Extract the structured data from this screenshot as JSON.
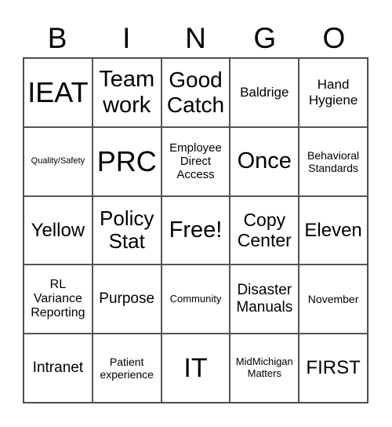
{
  "header": [
    "B",
    "I",
    "N",
    "G",
    "O"
  ],
  "cells": [
    "IEAT",
    "Team work",
    "Good Catch",
    "Baldrige",
    "Hand Hygiene",
    "Quality/Safety",
    "PRC",
    "Employee Direct Access",
    "Once",
    "Behavioral Standards",
    "Yellow",
    "Policy Stat",
    "Free!",
    "Copy Center",
    "Eleven",
    "RL Variance Reporting",
    "Purpose",
    "Community",
    "Disaster Manuals",
    "November",
    "Intranet",
    "Patient experience",
    "IT",
    "MidMichigan Matters",
    "FIRST"
  ]
}
